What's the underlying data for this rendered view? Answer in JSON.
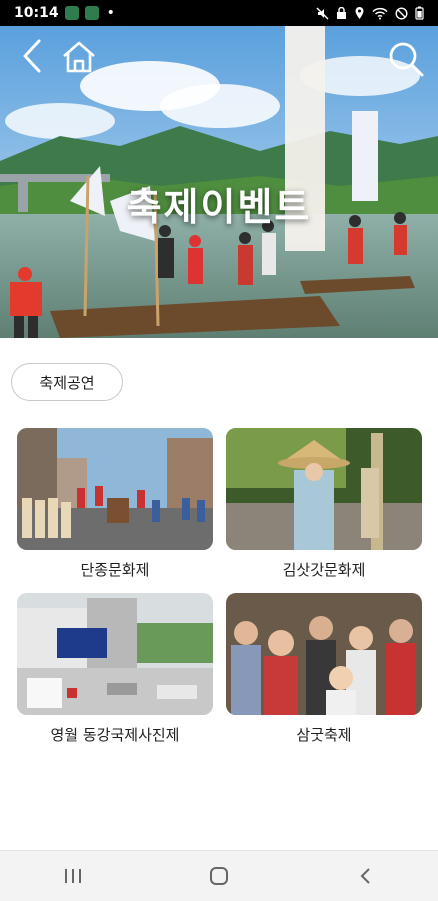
{
  "status_bar": {
    "time": "10:14",
    "dot": "•",
    "icons": [
      "app-icon",
      "app-icon",
      "mute-icon",
      "lock-icon",
      "location-icon",
      "wifi-icon",
      "dnd-icon",
      "battery-icon"
    ]
  },
  "hero": {
    "title": "축제이벤트",
    "back_icon": "chevron-left-icon",
    "home_icon": "home-icon",
    "search_icon": "search-icon"
  },
  "category": {
    "label": "축제공연"
  },
  "festivals": [
    {
      "name": "단종문화제"
    },
    {
      "name": "김삿갓문화제"
    },
    {
      "name": "영월 동강국제사진제"
    },
    {
      "name": "삼굿축제"
    }
  ],
  "nav": {
    "icons": [
      "recent-apps-icon",
      "home-circle-icon",
      "back-icon"
    ]
  }
}
